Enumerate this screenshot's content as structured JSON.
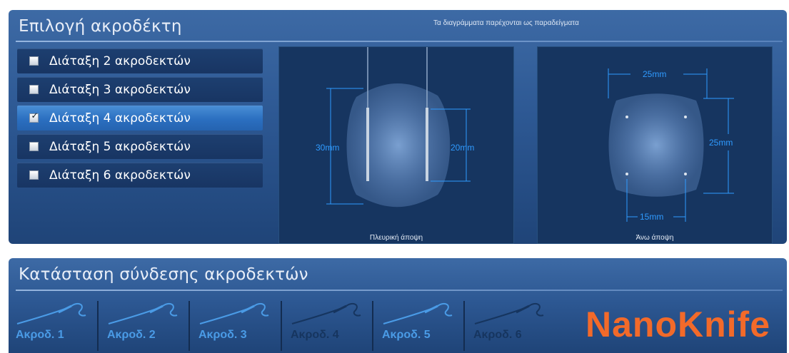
{
  "electrode_selection": {
    "title": "Επιλογή ακροδέκτη",
    "note": "Τα διαγράμματα παρέχονται ως παραδείγματα",
    "options": [
      {
        "label": "Διάταξη 2 ακροδεκτών",
        "checked": false
      },
      {
        "label": "Διάταξη 3 ακροδεκτών",
        "checked": false
      },
      {
        "label": "Διάταξη 4 ακροδεκτών",
        "checked": true
      },
      {
        "label": "Διάταξη 5 ακροδεκτών",
        "checked": false
      },
      {
        "label": "Διάταξη 6 ακροδεκτών",
        "checked": false
      }
    ],
    "check_glyph": "✓",
    "side_view": {
      "caption": "Πλευρική άποψη",
      "dim_height": "30mm",
      "dim_exposure": "20mm"
    },
    "top_view": {
      "caption": "Άνω άποψη",
      "dim_width": "25mm",
      "dim_height": "25mm",
      "dim_spacing": "15mm"
    }
  },
  "connection_status": {
    "title": "Κατάσταση σύνδεσης ακροδεκτών",
    "probes": [
      {
        "label": "Ακροδ. 1",
        "connected": true
      },
      {
        "label": "Ακροδ. 2",
        "connected": true
      },
      {
        "label": "Ακροδ. 3",
        "connected": true
      },
      {
        "label": "Ακροδ. 4",
        "connected": false
      },
      {
        "label": "Ακροδ. 5",
        "connected": true
      },
      {
        "label": "Ακροδ. 6",
        "connected": false
      }
    ]
  },
  "logo_text": "NanoKnife",
  "colors": {
    "panel_blue": "#2d5893",
    "selected_blue": "#3b7fcb",
    "dimension_blue": "#2f9bff",
    "connected_probe": "#4a9be6",
    "disconnected_probe": "#16355f",
    "logo_orange": "#f26a2a"
  }
}
